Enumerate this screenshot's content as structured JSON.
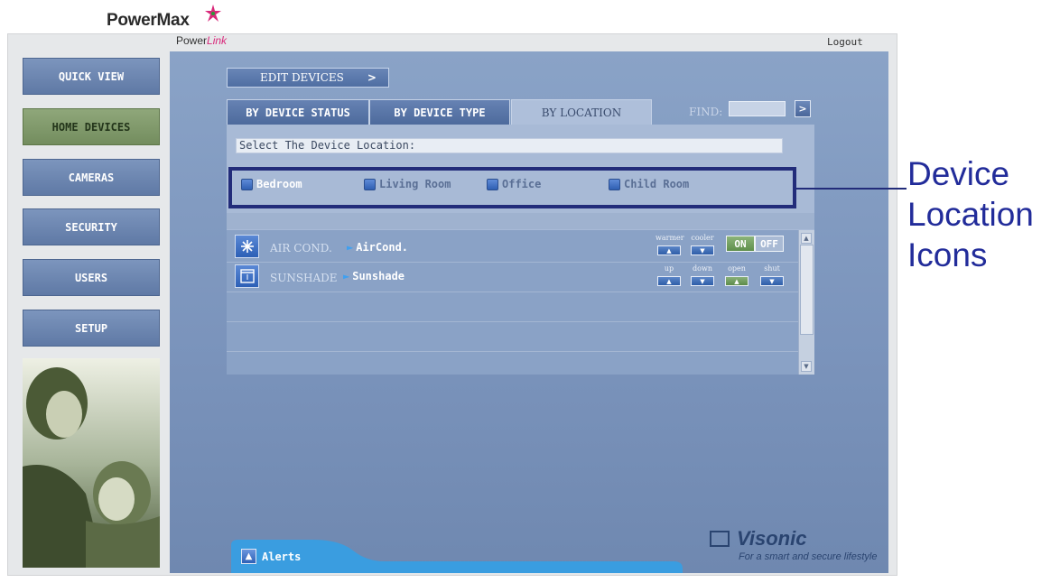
{
  "header": {
    "powermax_logo": "PowerMax",
    "powerlink_pre": "Power",
    "powerlink_link": "Link",
    "logout_label": "Logout"
  },
  "sidebar": {
    "items": [
      {
        "label": "QUICK VIEW",
        "active": false
      },
      {
        "label": "HOME DEVICES",
        "active": true
      },
      {
        "label": "CAMERAS",
        "active": false
      },
      {
        "label": "SECURITY",
        "active": false
      },
      {
        "label": "USERS",
        "active": false
      },
      {
        "label": "SETUP",
        "active": false
      }
    ]
  },
  "main": {
    "edit_devices_label": "EDIT DEVICES",
    "edit_devices_arrow": ">",
    "tabs": [
      {
        "label": "BY DEVICE STATUS",
        "selected": false
      },
      {
        "label": "BY DEVICE TYPE",
        "selected": false
      },
      {
        "label": "BY LOCATION",
        "selected": true
      }
    ],
    "find_label": "FIND:",
    "find_value": "",
    "prompt": "Select The Device Location:",
    "locations": [
      {
        "label": "Bedroom",
        "selected": true
      },
      {
        "label": "Living Room",
        "selected": false
      },
      {
        "label": "Office",
        "selected": false
      },
      {
        "label": "Child Room",
        "selected": false
      }
    ],
    "devices": [
      {
        "type": "AIR COND.",
        "name": "AirCond.",
        "icon": "snowflake-icon",
        "controls": {
          "warmer": "warmer",
          "cooler": "cooler",
          "on": "ON",
          "off": "OFF"
        }
      },
      {
        "type": "SUNSHADE",
        "name": "Sunshade",
        "icon": "sunshade-icon",
        "controls": {
          "up": "up",
          "down": "down",
          "open": "open",
          "shut": "shut"
        }
      }
    ]
  },
  "footer": {
    "alerts_label": "Alerts",
    "brand": "Visonic",
    "tagline": "For a smart and secure lifestyle"
  },
  "annotation": {
    "lines": [
      "Device",
      "Location",
      "Icons"
    ]
  },
  "colors": {
    "nav_blue": "#6a84af",
    "nav_active_green": "#809a6b",
    "panel_blue": "#7b94bc",
    "annotation_navy": "#222c7a"
  }
}
